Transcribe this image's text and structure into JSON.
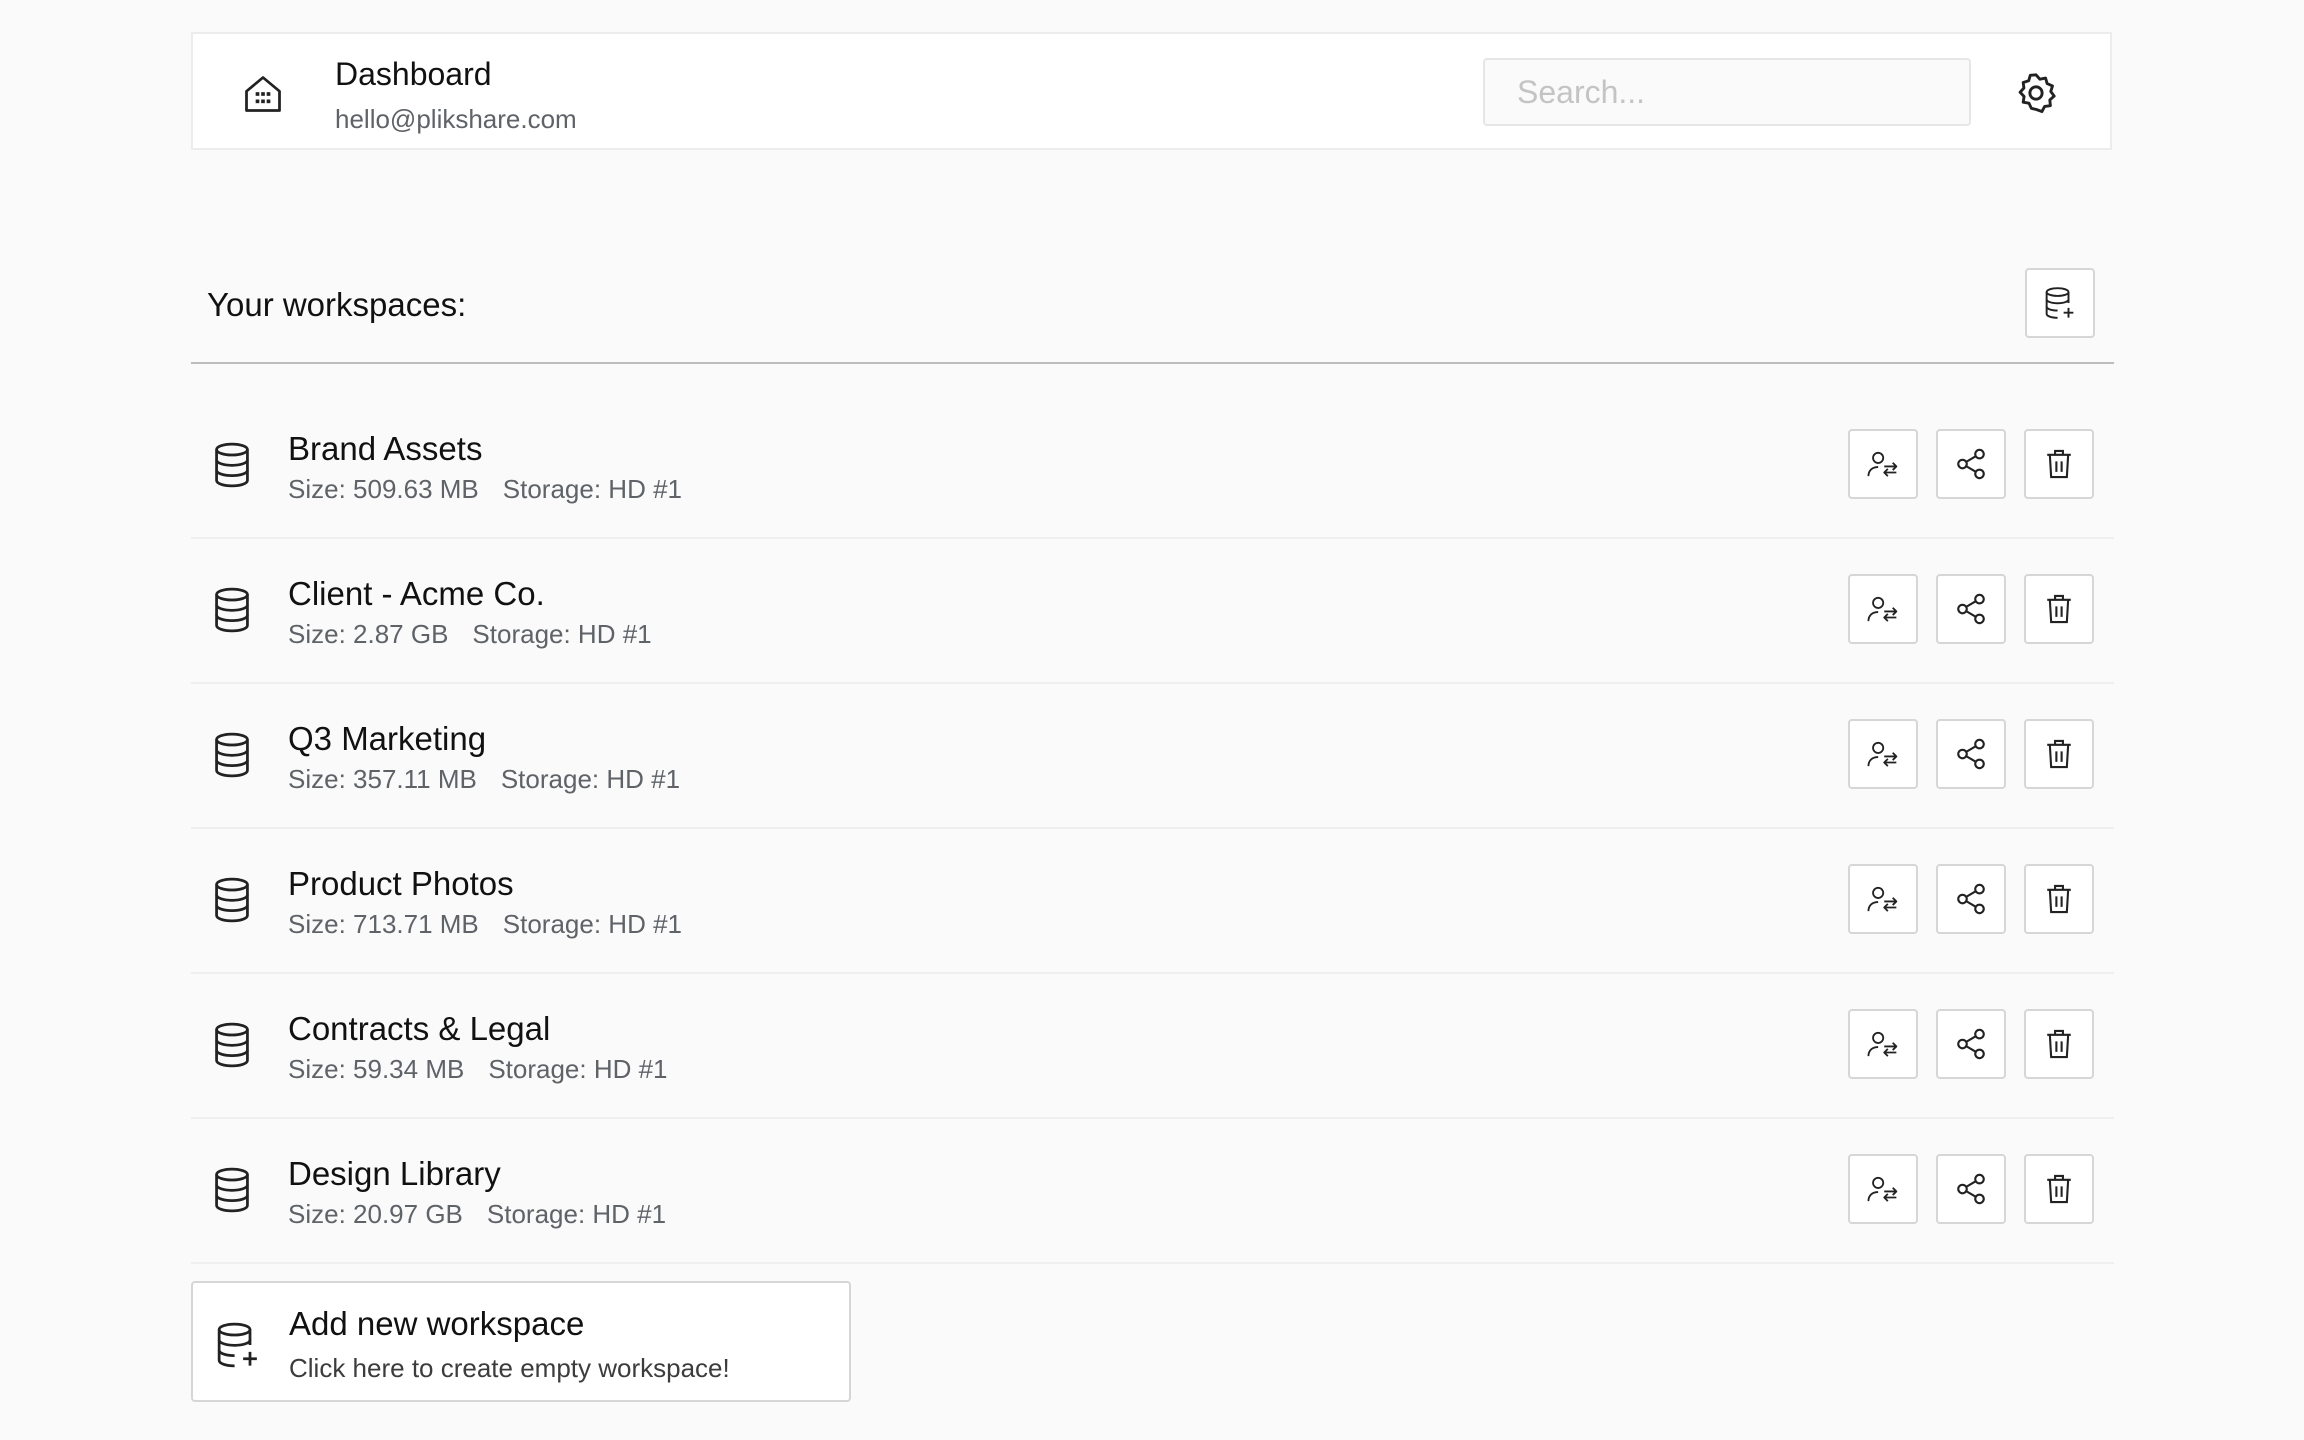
{
  "header": {
    "title": "Dashboard",
    "email": "hello@plikshare.com",
    "search_placeholder": "Search...",
    "home_icon": "home-icon",
    "settings_icon": "gear-icon"
  },
  "workspaces_section": {
    "title": "Your workspaces:",
    "add_icon": "database-plus-icon"
  },
  "workspaces": [
    {
      "name": "Brand Assets",
      "size": "Size: 509.63 MB",
      "storage": "Storage: HD #1"
    },
    {
      "name": "Client - Acme Co.",
      "size": "Size: 2.87 GB",
      "storage": "Storage: HD #1"
    },
    {
      "name": "Q3 Marketing",
      "size": "Size: 357.11 MB",
      "storage": "Storage: HD #1"
    },
    {
      "name": "Product Photos",
      "size": "Size: 713.71 MB",
      "storage": "Storage: HD #1"
    },
    {
      "name": "Contracts & Legal",
      "size": "Size: 59.34 MB",
      "storage": "Storage: HD #1"
    },
    {
      "name": "Design Library",
      "size": "Size: 20.97 GB",
      "storage": "Storage: HD #1"
    }
  ],
  "row_actions": [
    "transfer-owner-icon",
    "share-icon",
    "trash-icon"
  ],
  "add_workspace": {
    "title": "Add new workspace",
    "subtitle": "Click here to create empty workspace!"
  },
  "colors": {
    "background": "#fafafa",
    "text": "#111111",
    "muted_text": "#5f6368",
    "border": "#d6d6d6"
  }
}
